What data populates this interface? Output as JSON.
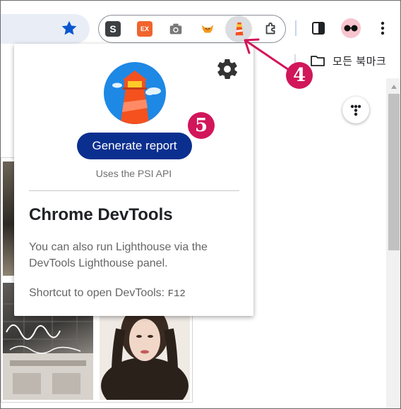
{
  "toolbar": {
    "extensions": [
      {
        "name": "s-extension",
        "label": "S"
      },
      {
        "name": "ex-extension",
        "label": "EX"
      },
      {
        "name": "camera-extension",
        "label": ""
      },
      {
        "name": "fox-extension",
        "label": ""
      },
      {
        "name": "lighthouse-extension",
        "label": ""
      },
      {
        "name": "extensions-menu",
        "label": ""
      }
    ]
  },
  "bookmarks": {
    "all_bookmarks_label": "모든 북마크"
  },
  "popup": {
    "generate_button": "Generate report",
    "psi_note": "Uses the PSI API",
    "devtools_title": "Chrome DevTools",
    "devtools_desc": "You can also run Lighthouse via the DevTools Lighthouse panel.",
    "shortcut_label": "Shortcut to open DevTools:",
    "shortcut_key": "F12"
  },
  "annotations": {
    "step4": "4",
    "step5": "5"
  },
  "colors": {
    "accent": "#0b2f8f",
    "badge": "#d1165a",
    "star": "#0b57d0"
  },
  "icons": [
    "star-icon",
    "camera-icon",
    "fox-icon",
    "lighthouse-icon",
    "puzzle-icon",
    "side-panel-icon",
    "more-vert-icon",
    "folder-icon",
    "gear-icon"
  ]
}
